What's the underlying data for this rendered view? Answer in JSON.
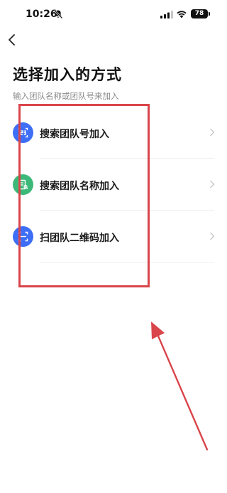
{
  "status_bar": {
    "time": "10:26",
    "battery": "78"
  },
  "header": {
    "title": "选择加入的方式",
    "subtitle": "输入团队名称或团队号来加入"
  },
  "options": [
    {
      "label": "搜索团队号加入",
      "icon": "team-number-icon",
      "color": "#3d6ef5"
    },
    {
      "label": "搜索团队名称加入",
      "icon": "team-name-icon",
      "color": "#3cb878"
    },
    {
      "label": "扫团队二维码加入",
      "icon": "scan-qr-icon",
      "color": "#3d6ef5"
    }
  ],
  "colors": {
    "annotation": "#d9454a"
  }
}
